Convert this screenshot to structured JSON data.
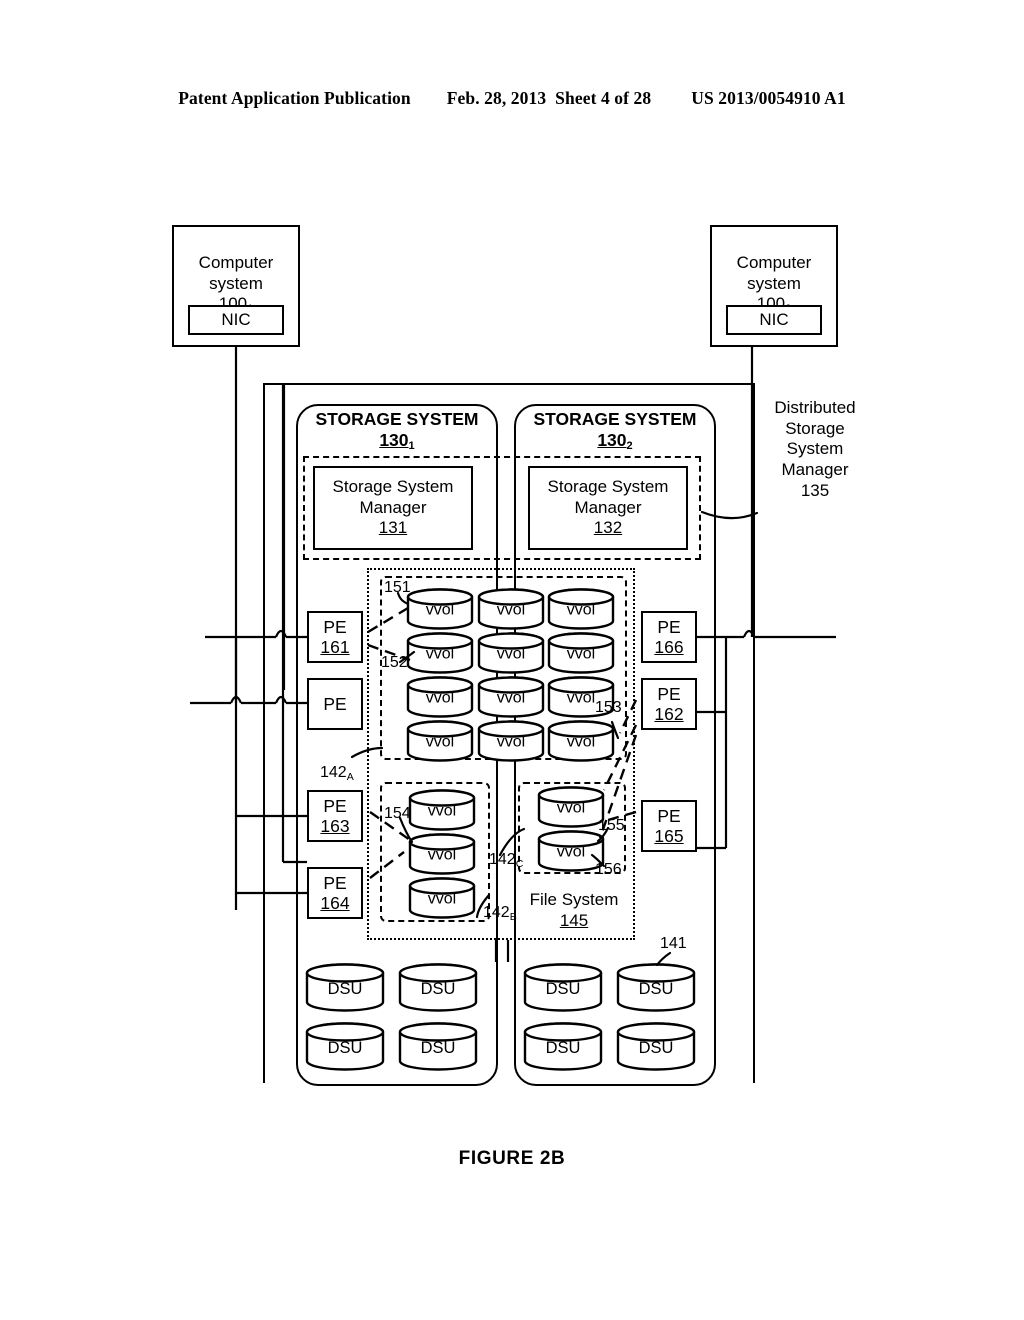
{
  "header": {
    "publication": "Patent Application Publication",
    "date": "Feb. 28, 2013",
    "sheet": "Sheet 4 of 28",
    "docnum": "US 2013/0054910 A1"
  },
  "figure": {
    "caption": "FIGURE 2B"
  },
  "computer_systems": [
    {
      "line1": "Computer",
      "line2": "system",
      "ref": "100",
      "ref_sub": "1",
      "nic": "NIC"
    },
    {
      "line1": "Computer",
      "line2": "system",
      "ref": "100",
      "ref_sub": "2",
      "nic": "NIC"
    }
  ],
  "distributed_manager": {
    "line1": "Distributed",
    "line2": "Storage",
    "line3": "System",
    "line4": "Manager",
    "ref": "135"
  },
  "storage_systems": [
    {
      "title": "STORAGE SYSTEM",
      "ref": "130",
      "ref_sub": "1"
    },
    {
      "title": "STORAGE SYSTEM",
      "ref": "130",
      "ref_sub": "2"
    }
  ],
  "storage_system_managers": [
    {
      "line1": "Storage System",
      "line2": "Manager",
      "ref": "131"
    },
    {
      "line1": "Storage System",
      "line2": "Manager",
      "ref": "132"
    }
  ],
  "protocol_endpoints": [
    {
      "label": "PE",
      "ref": "161"
    },
    {
      "label": "PE",
      "ref": ""
    },
    {
      "label": "PE",
      "ref": "163"
    },
    {
      "label": "PE",
      "ref": "164"
    },
    {
      "label": "PE",
      "ref": "166"
    },
    {
      "label": "PE",
      "ref": "162"
    },
    {
      "label": "PE",
      "ref": "165"
    }
  ],
  "file_system": {
    "label": "File System",
    "ref": "145"
  },
  "vvol_label": "vvol",
  "dsu_label": "DSU",
  "vvol_group_a": {
    "rows": [
      [
        "vvol",
        "vvol",
        "vvol"
      ],
      [
        "vvol",
        "vvol",
        "vvol"
      ],
      [
        "vvol",
        "vvol",
        "vvol"
      ],
      [
        "vvol",
        "vvol",
        "vvol"
      ]
    ]
  },
  "vvol_group_b": {
    "items": [
      "vvol",
      "vvol",
      "vvol"
    ]
  },
  "vvol_group_c": {
    "items": [
      "vvol",
      "vvol"
    ]
  },
  "dsu_groups": [
    {
      "items": [
        "DSU",
        "DSU",
        "DSU",
        "DSU"
      ]
    },
    {
      "items": [
        "DSU",
        "DSU",
        "DSU",
        "DSU"
      ]
    }
  ],
  "refs": {
    "r151": "151",
    "r152": "152",
    "r153": "153",
    "r154": "154",
    "r155": "155",
    "r156": "156",
    "r141": "141",
    "r142a": "142",
    "r142a_sub": "A",
    "r142b": "142",
    "r142b_sub": "B",
    "r142c": "142",
    "r142c_sub": "C"
  },
  "colors": {
    "ink": "#000000",
    "paper": "#ffffff"
  }
}
